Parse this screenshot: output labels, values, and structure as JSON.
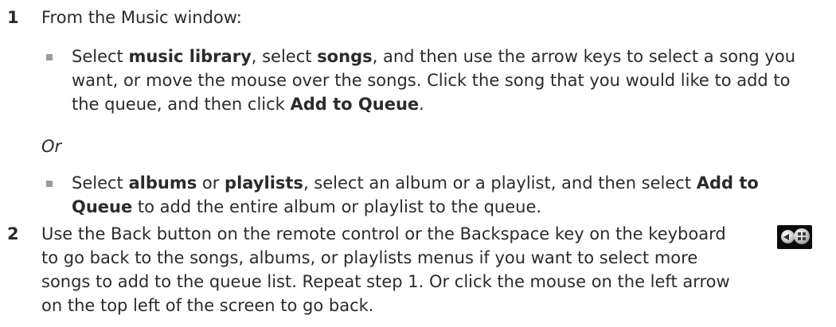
{
  "step1": {
    "number": "1",
    "intro": "From the Music window:",
    "bullet1": {
      "p1": "Select ",
      "b1": "music library",
      "p2": ", select ",
      "b2": "songs",
      "p3": ", and then use the arrow keys to select a song you want, or move the mouse over the songs. Click the song that you would like to add to the queue, and then click ",
      "b3": "Add to Queue",
      "p4": "."
    },
    "or_label": "Or",
    "bullet2": {
      "p1": "Select ",
      "b1": "albums",
      "p2": " or ",
      "b2": "playlists",
      "p3": ", select an album or a playlist, and then select ",
      "b3": "Add to Queue",
      "p4": " to add the entire album or playlist to the queue."
    }
  },
  "step2": {
    "number": "2",
    "text": "Use the Back button on the remote control or the Backspace key on the keyboard to go back to the songs, albums, or playlists menus if you want to select more songs to add to the queue list. Repeat step 1. Or click the mouse on the left arrow on the top left of the screen to go back.",
    "icon": "back-button-icon"
  }
}
